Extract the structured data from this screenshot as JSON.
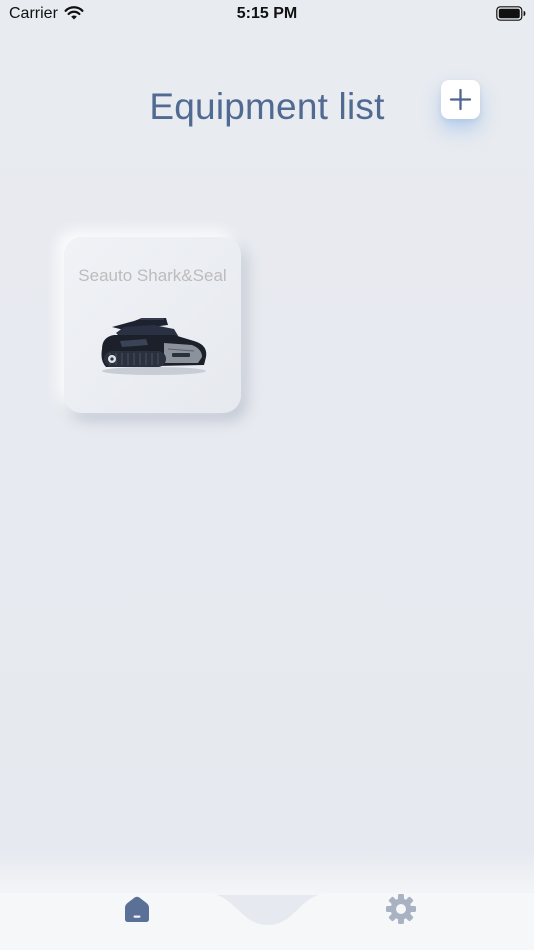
{
  "status_bar": {
    "carrier": "Carrier",
    "time": "5:15 PM"
  },
  "header": {
    "title": "Equipment list",
    "add_icon": "plus-icon"
  },
  "equipment": [
    {
      "name": "Seauto Shark&Seal",
      "image": "pool-robot-image"
    }
  ],
  "tab_bar": {
    "items": [
      {
        "icon": "home-icon",
        "active": true
      },
      {
        "icon": "gear-icon",
        "active": false
      }
    ]
  },
  "colors": {
    "background": "#e7eaef",
    "title": "#516a91",
    "accent": "#5a7097",
    "card_text": "#bcbcbc",
    "inactive_icon": "#a9b2c2"
  }
}
